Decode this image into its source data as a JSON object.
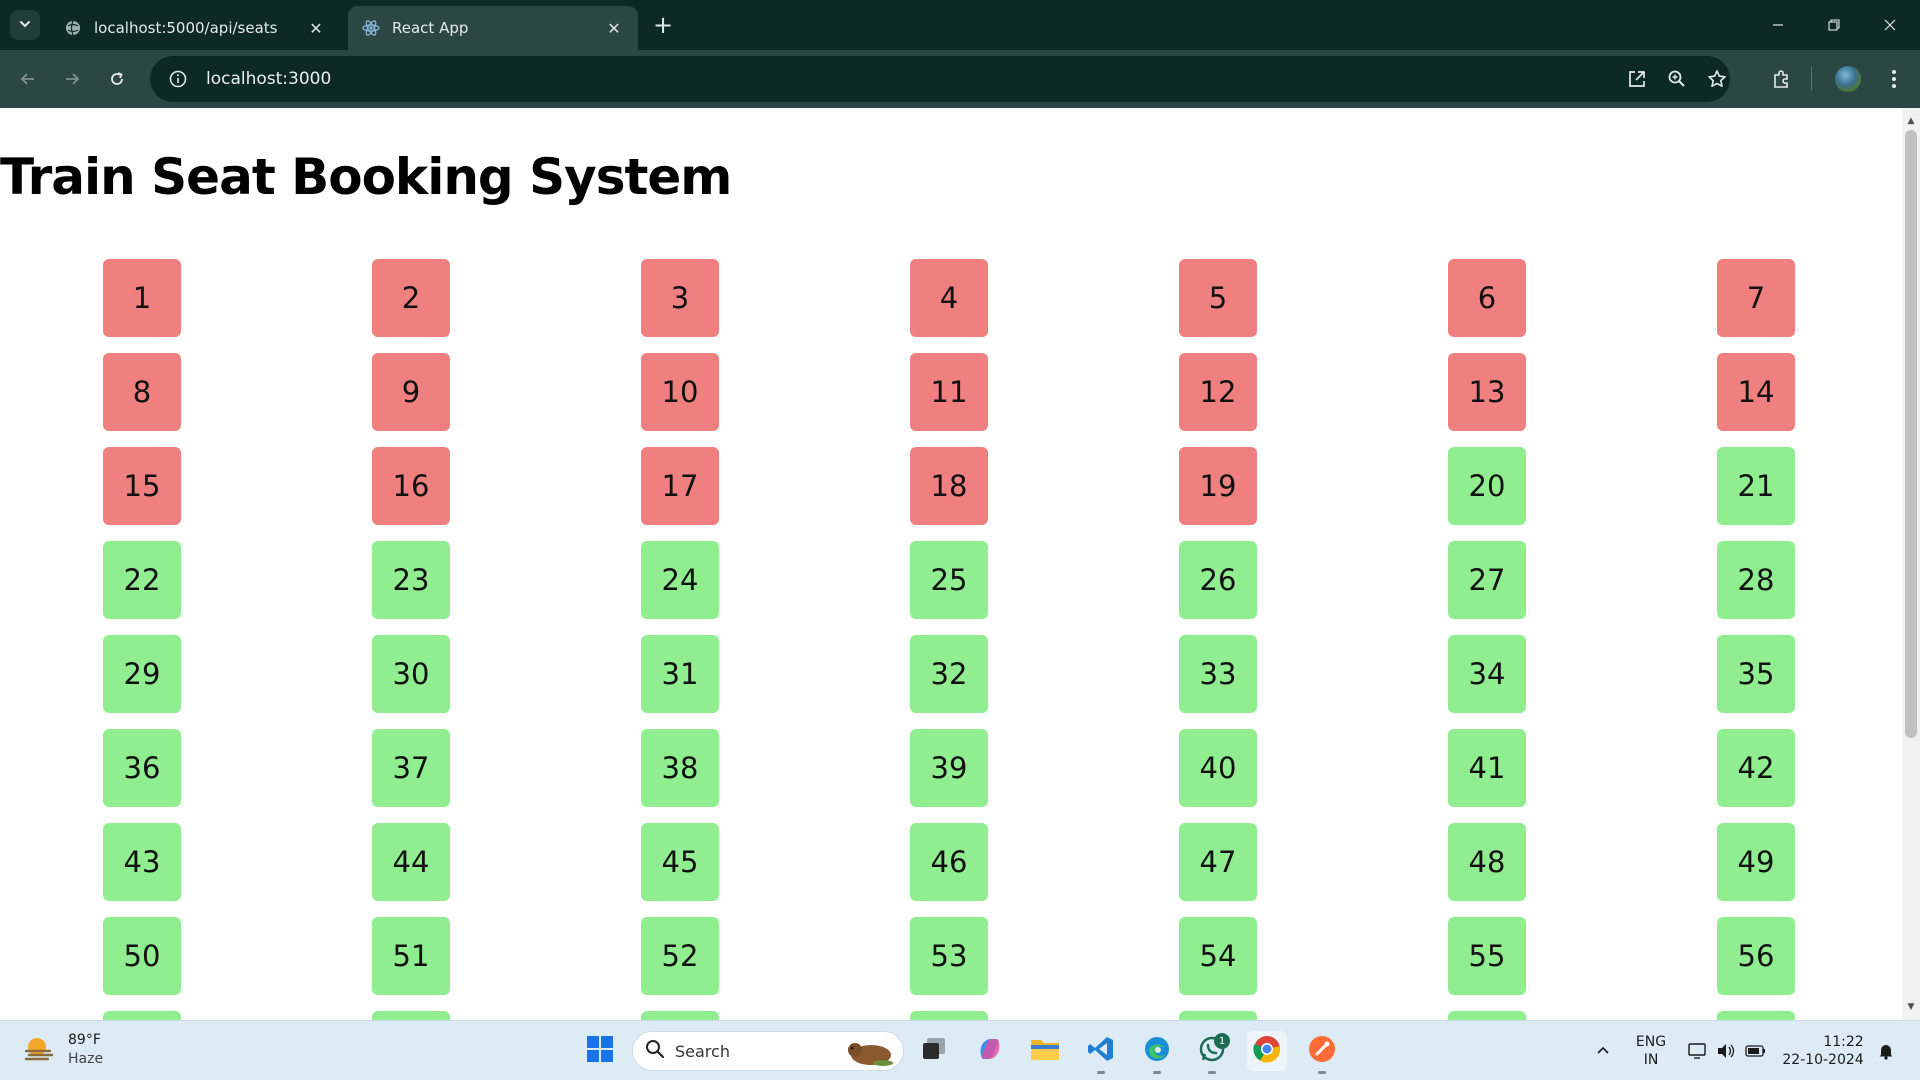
{
  "browser": {
    "tabs": [
      {
        "title": "localhost:5000/api/seats",
        "active": false,
        "icon": "globe-icon"
      },
      {
        "title": "React App",
        "active": true,
        "icon": "react-icon"
      }
    ],
    "url": "localhost:3000",
    "accent": "#0d2926"
  },
  "page": {
    "title": "Train Seat Booking System",
    "seat_colors": {
      "booked": "#f08080",
      "available": "#90ee90"
    },
    "seats": [
      {
        "number": "1",
        "status": "booked"
      },
      {
        "number": "2",
        "status": "booked"
      },
      {
        "number": "3",
        "status": "booked"
      },
      {
        "number": "4",
        "status": "booked"
      },
      {
        "number": "5",
        "status": "booked"
      },
      {
        "number": "6",
        "status": "booked"
      },
      {
        "number": "7",
        "status": "booked"
      },
      {
        "number": "8",
        "status": "booked"
      },
      {
        "number": "9",
        "status": "booked"
      },
      {
        "number": "10",
        "status": "booked"
      },
      {
        "number": "11",
        "status": "booked"
      },
      {
        "number": "12",
        "status": "booked"
      },
      {
        "number": "13",
        "status": "booked"
      },
      {
        "number": "14",
        "status": "booked"
      },
      {
        "number": "15",
        "status": "booked"
      },
      {
        "number": "16",
        "status": "booked"
      },
      {
        "number": "17",
        "status": "booked"
      },
      {
        "number": "18",
        "status": "booked"
      },
      {
        "number": "19",
        "status": "booked"
      },
      {
        "number": "20",
        "status": "available"
      },
      {
        "number": "21",
        "status": "available"
      },
      {
        "number": "22",
        "status": "available"
      },
      {
        "number": "23",
        "status": "available"
      },
      {
        "number": "24",
        "status": "available"
      },
      {
        "number": "25",
        "status": "available"
      },
      {
        "number": "26",
        "status": "available"
      },
      {
        "number": "27",
        "status": "available"
      },
      {
        "number": "28",
        "status": "available"
      },
      {
        "number": "29",
        "status": "available"
      },
      {
        "number": "30",
        "status": "available"
      },
      {
        "number": "31",
        "status": "available"
      },
      {
        "number": "32",
        "status": "available"
      },
      {
        "number": "33",
        "status": "available"
      },
      {
        "number": "34",
        "status": "available"
      },
      {
        "number": "35",
        "status": "available"
      },
      {
        "number": "36",
        "status": "available"
      },
      {
        "number": "37",
        "status": "available"
      },
      {
        "number": "38",
        "status": "available"
      },
      {
        "number": "39",
        "status": "available"
      },
      {
        "number": "40",
        "status": "available"
      },
      {
        "number": "41",
        "status": "available"
      },
      {
        "number": "42",
        "status": "available"
      },
      {
        "number": "43",
        "status": "available"
      },
      {
        "number": "44",
        "status": "available"
      },
      {
        "number": "45",
        "status": "available"
      },
      {
        "number": "46",
        "status": "available"
      },
      {
        "number": "47",
        "status": "available"
      },
      {
        "number": "48",
        "status": "available"
      },
      {
        "number": "49",
        "status": "available"
      },
      {
        "number": "50",
        "status": "available"
      },
      {
        "number": "51",
        "status": "available"
      },
      {
        "number": "52",
        "status": "available"
      },
      {
        "number": "53",
        "status": "available"
      },
      {
        "number": "54",
        "status": "available"
      },
      {
        "number": "55",
        "status": "available"
      },
      {
        "number": "56",
        "status": "available"
      },
      {
        "number": "",
        "status": "available"
      },
      {
        "number": "",
        "status": "available"
      },
      {
        "number": "",
        "status": "available"
      },
      {
        "number": "",
        "status": "available"
      },
      {
        "number": "",
        "status": "available"
      },
      {
        "number": "",
        "status": "available"
      },
      {
        "number": "",
        "status": "available"
      }
    ]
  },
  "taskbar": {
    "weather": {
      "temp": "89°F",
      "condition": "Haze"
    },
    "search_placeholder": "Search",
    "whatsapp_badge": "1",
    "language": {
      "line1": "ENG",
      "line2": "IN"
    },
    "clock": {
      "time": "11:22",
      "date": "22-10-2024"
    }
  }
}
